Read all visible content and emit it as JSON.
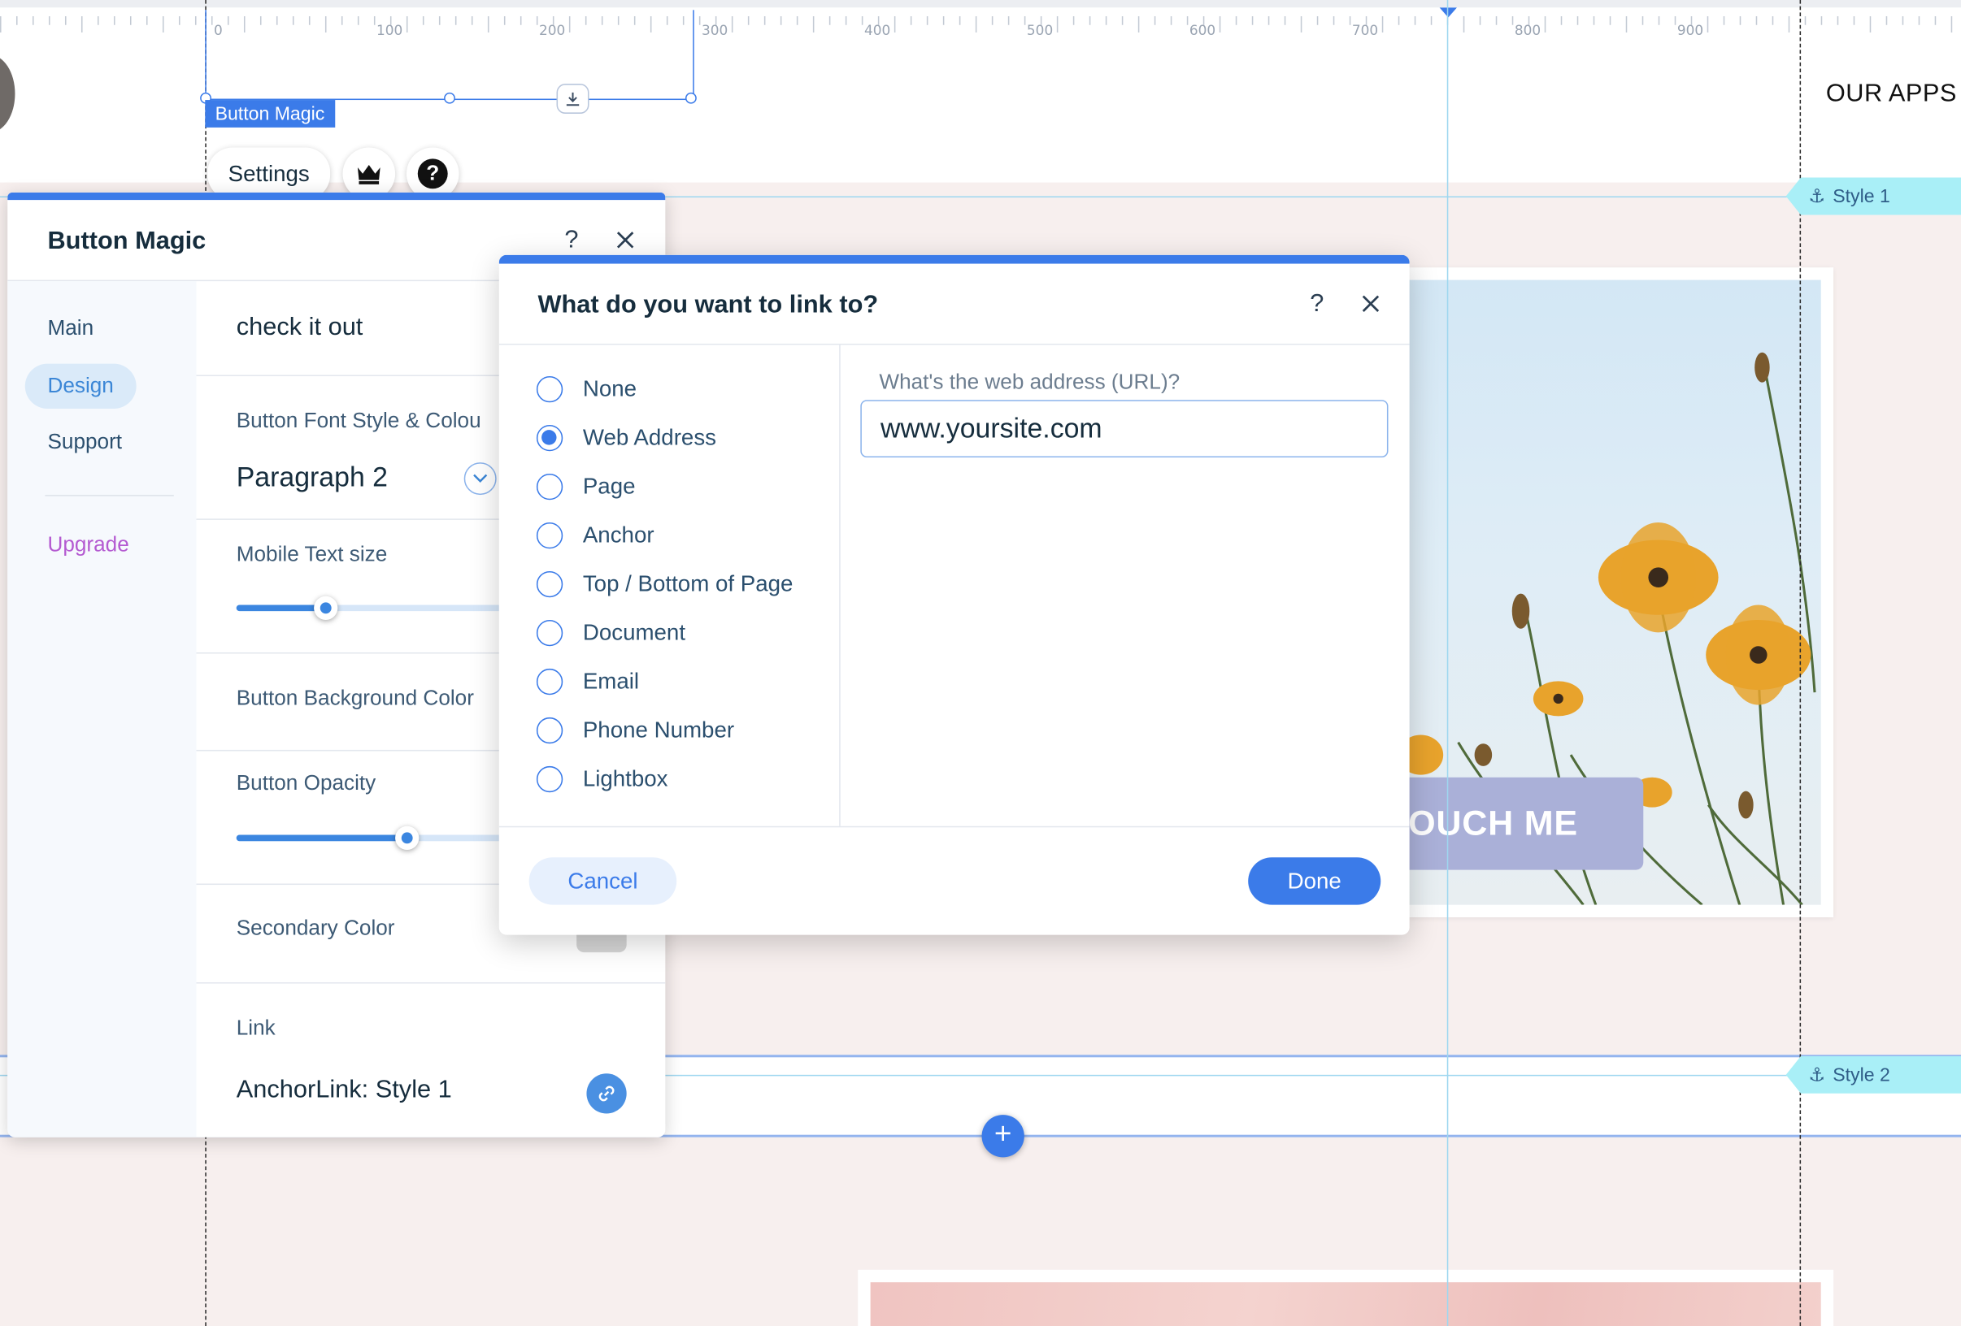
{
  "ruler": {
    "ticks": [
      "0",
      "100",
      "200",
      "300",
      "400",
      "500",
      "600",
      "700",
      "800",
      "900"
    ]
  },
  "canvas": {
    "header_text": "OUR APPS",
    "anchor_style1": "Style 1",
    "anchor_style2": "Style 2",
    "button_text": "OUCH ME"
  },
  "selection": {
    "label": "Button Magic"
  },
  "toolbar": {
    "settings_label": "Settings"
  },
  "panel": {
    "title": "Button Magic",
    "nav": {
      "main": "Main",
      "design": "Design",
      "support": "Support",
      "upgrade": "Upgrade"
    },
    "button_text_value": "check it out",
    "font_style_label": "Button Font Style & Colou",
    "font_style_value": "Paragraph 2",
    "mobile_text_size_label": "Mobile Text size",
    "mobile_text_size_level": 0.21,
    "background_color_label": "Button Background Color",
    "opacity_label": "Button Opacity",
    "opacity_level": 0.4,
    "secondary_color_label": "Secondary Color",
    "link_label": "Link",
    "link_value": "AnchorLink: Style 1"
  },
  "dialog": {
    "title": "What do you want to link to?",
    "options": [
      {
        "label": "None",
        "selected": false
      },
      {
        "label": "Web Address",
        "selected": true
      },
      {
        "label": "Page",
        "selected": false
      },
      {
        "label": "Anchor",
        "selected": false
      },
      {
        "label": "Top / Bottom of Page",
        "selected": false
      },
      {
        "label": "Document",
        "selected": false
      },
      {
        "label": "Email",
        "selected": false
      },
      {
        "label": "Phone Number",
        "selected": false
      },
      {
        "label": "Lightbox",
        "selected": false
      }
    ],
    "url_label": "What's the web address (URL)?",
    "url_value": "www.yoursite.com",
    "cancel_label": "Cancel",
    "done_label": "Done"
  },
  "colors": {
    "accent": "#3b7be9",
    "canvas_pink": "#f7efee",
    "anchor_tag": "#a9eff7",
    "upgrade": "#b45ad1",
    "cta_button": "#aab0d8"
  }
}
